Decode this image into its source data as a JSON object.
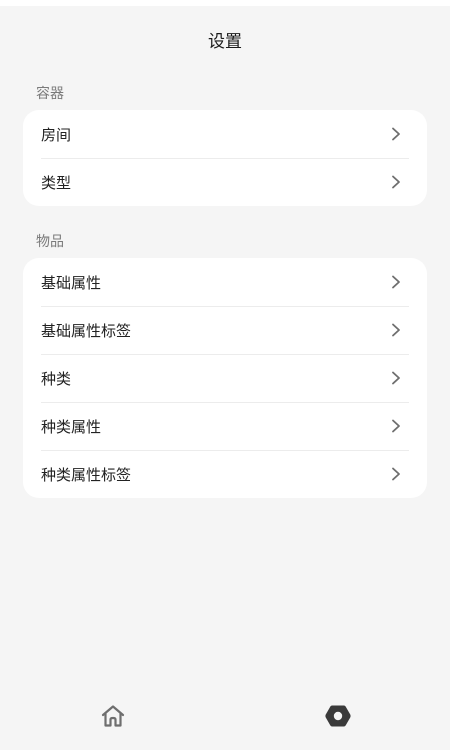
{
  "header": {
    "title": "设置"
  },
  "sections": [
    {
      "title": "容器",
      "items": [
        {
          "label": "房间"
        },
        {
          "label": "类型"
        }
      ]
    },
    {
      "title": "物品",
      "items": [
        {
          "label": "基础属性"
        },
        {
          "label": "基础属性标签"
        },
        {
          "label": "种类"
        },
        {
          "label": "种类属性"
        },
        {
          "label": "种类属性标签"
        }
      ]
    }
  ],
  "bottom_nav": {
    "items": [
      {
        "icon": "home-icon",
        "active": false
      },
      {
        "icon": "settings-icon",
        "active": true
      }
    ]
  },
  "colors": {
    "background": "#f5f5f5",
    "card": "#ffffff",
    "section_title": "#7a7a7a",
    "chevron": "#6e6e6e",
    "nav_home": "#6e6e6e",
    "nav_settings_active": "#3a3a3a"
  }
}
